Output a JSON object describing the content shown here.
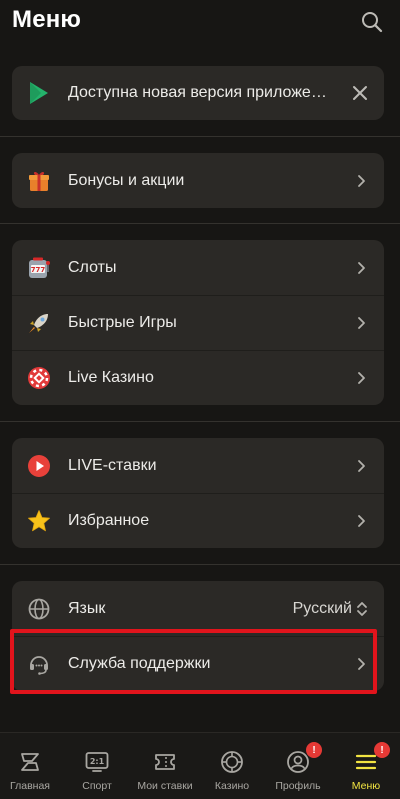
{
  "header": {
    "title": "Меню"
  },
  "update_banner": {
    "text": "Доступна новая версия приложения"
  },
  "promos": {
    "items": [
      {
        "label": "Бонусы и акции"
      }
    ]
  },
  "casino": {
    "items": [
      {
        "label": "Слоты"
      },
      {
        "label": "Быстрые Игры"
      },
      {
        "label": "Live Казино"
      }
    ]
  },
  "sports": {
    "items": [
      {
        "label": "LIVE-ставки"
      },
      {
        "label": "Избранное"
      }
    ]
  },
  "settings": {
    "language": {
      "label": "Язык",
      "value": "Русский"
    },
    "support": {
      "label": "Служба поддержки"
    }
  },
  "tabbar": {
    "items": [
      {
        "label": "Главная"
      },
      {
        "label": "Спорт",
        "icon_text": "2:1"
      },
      {
        "label": "Мои ставки"
      },
      {
        "label": "Казино"
      },
      {
        "label": "Профиль",
        "badge": "!"
      },
      {
        "label": "Меню",
        "badge": "!"
      }
    ]
  },
  "colors": {
    "accent": "#f2e442",
    "badge": "#e53935",
    "highlight": "#e1141c",
    "card": "#2b2926",
    "background": "#171614"
  }
}
